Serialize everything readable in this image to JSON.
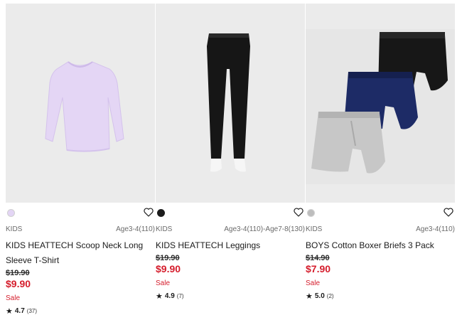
{
  "products": [
    {
      "category": "KIDS",
      "size": "Age3-4(110)",
      "name_line1": "KIDS HEATTECH Scoop Neck Long",
      "name_line2": "Sleeve T-Shirt",
      "original_price": "$19.90",
      "price": "$9.90",
      "sale_label": "Sale",
      "rating_star": "★",
      "rating": "4.7",
      "review_count": "(37)",
      "swatch_color": "#e3d5f5",
      "image_icon": "long-sleeve-tshirt-icon"
    },
    {
      "category": "KIDS",
      "size": "Age3-4(110)-Age7-8(130)",
      "name_line1": "KIDS HEATTECH Leggings",
      "original_price": "$19.90",
      "price": "$9.90",
      "sale_label": "Sale",
      "rating_star": "★",
      "rating": "4.9",
      "review_count": "(7)",
      "swatch_color": "#1c1c1c",
      "image_icon": "leggings-icon"
    },
    {
      "category": "KIDS",
      "size": "Age3-4(110)",
      "name_line1": "BOYS Cotton Boxer Briefs 3 Pack",
      "original_price": "$14.90",
      "price": "$7.90",
      "sale_label": "Sale",
      "rating_star": "★",
      "rating": "5.0",
      "review_count": "(2)",
      "swatch_color": "#bdbdbd",
      "image_icon": "boxer-briefs-icon"
    }
  ],
  "colors": {
    "sale_red": "#d51d2c",
    "image_bg": "#ebebeb"
  }
}
